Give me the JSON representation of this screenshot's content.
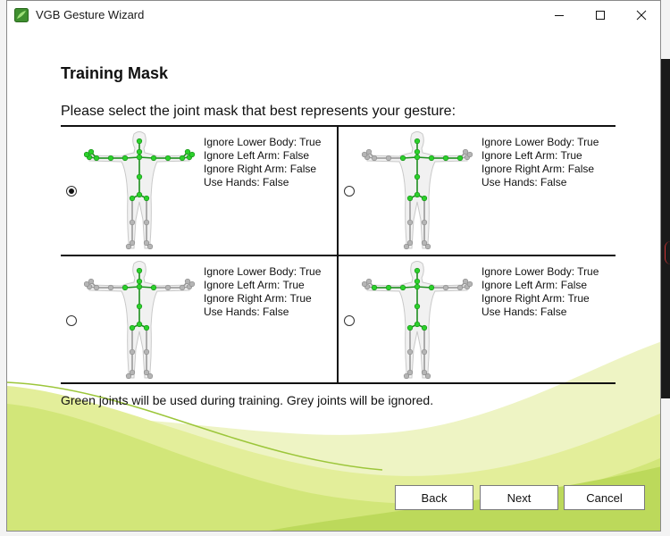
{
  "window": {
    "title": "VGB Gesture Wizard",
    "icon": "vgb-app-icon",
    "controls": [
      "minimize-icon",
      "maximize-icon",
      "close-icon"
    ]
  },
  "page": {
    "heading": "Training Mask",
    "prompt": "Please select the joint mask that best represents your gesture:",
    "footer_note": "Green joints will be used during training. Grey joints will be ignored."
  },
  "options": [
    {
      "selected": true,
      "lines": [
        "Ignore Lower Body: True",
        "Ignore Left Arm: False",
        "Ignore Right Arm: False",
        "Use Hands: False"
      ],
      "left_arm_active": true,
      "right_arm_active": true,
      "hands_active": true
    },
    {
      "selected": false,
      "lines": [
        "Ignore Lower Body: True",
        "Ignore Left Arm: True",
        "Ignore Right Arm: False",
        "Use Hands: False"
      ],
      "left_arm_active": false,
      "right_arm_active": true,
      "hands_active": false
    },
    {
      "selected": false,
      "lines": [
        "Ignore Lower Body: True",
        "Ignore Left Arm: True",
        "Ignore Right Arm: True",
        "Use Hands: False"
      ],
      "left_arm_active": false,
      "right_arm_active": false,
      "hands_active": false
    },
    {
      "selected": false,
      "lines": [
        "Ignore Lower Body: True",
        "Ignore Left Arm: False",
        "Ignore Right Arm: True",
        "Use Hands: False"
      ],
      "left_arm_active": true,
      "right_arm_active": false,
      "hands_active": false
    }
  ],
  "buttons": {
    "back": "Back",
    "next": "Next",
    "cancel": "Cancel"
  },
  "colors": {
    "active_joint": "#2bd12b",
    "active_bone": "#1e8f1e",
    "ignored_joint": "#b5b5b5",
    "ignored_bone": "#9a9a9a",
    "wave_light": "#e6ef9c",
    "wave_mid": "#c6df6a",
    "wave_dark": "#9cc63a"
  }
}
